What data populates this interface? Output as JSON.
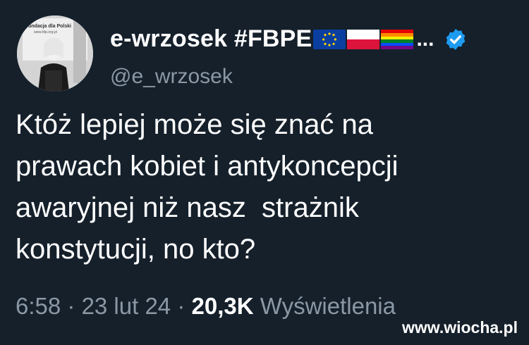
{
  "author": {
    "display_name": "e-wrzosek #FBPE",
    "handle": "@e_wrzosek",
    "flags": [
      "eu-flag-icon",
      "poland-flag-icon",
      "rainbow-flag-icon"
    ],
    "truncation": "...",
    "verified": true,
    "avatar_banner_text": "undacja dla Polski",
    "avatar_banner_sub": "www.fdp.org.pl"
  },
  "tweet": {
    "text": "Któż lepiej może się znać na\nprawach kobiet i antykoncepcji\nawaryjnej niż nasz  strażnik\nkonstytucji, no kto?"
  },
  "meta": {
    "time": "6:58",
    "separator": " · ",
    "date": "23 lut 24",
    "views_count": "20,3K",
    "views_label": " Wyświetlenia"
  },
  "watermark": "www.wiocha.pl",
  "colors": {
    "background": "#15202b",
    "text": "#ffffff",
    "secondary": "#8b98a5",
    "verified": "#1d9bf0"
  }
}
